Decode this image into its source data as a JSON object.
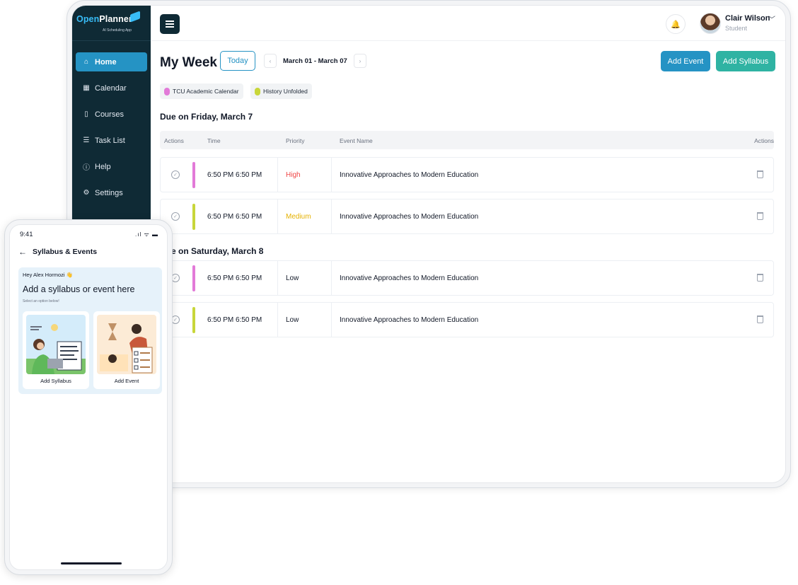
{
  "app": {
    "logo_open": "Open",
    "logo_planner": "Planner",
    "logo_sub": "AI Scheduling App"
  },
  "sidebar": {
    "items": [
      {
        "label": "Home",
        "icon": "home-icon",
        "glyph": "⌂",
        "active": true
      },
      {
        "label": "Calendar",
        "icon": "calendar-icon",
        "glyph": "▦",
        "active": false
      },
      {
        "label": "Courses",
        "icon": "book-icon",
        "glyph": "▯",
        "active": false
      },
      {
        "label": "Task List",
        "icon": "task-list-icon",
        "glyph": "☰",
        "active": false
      },
      {
        "label": "Help",
        "icon": "help-icon",
        "glyph": "ⓘ",
        "active": false
      },
      {
        "label": "Settings",
        "icon": "settings-icon",
        "glyph": "⚙",
        "active": false
      }
    ]
  },
  "header": {
    "user_name": "Clair Wilson",
    "user_role": "Student"
  },
  "main": {
    "title": "My Week",
    "today_label": "Today",
    "prev_label": "‹",
    "next_label": "›",
    "date_range": "March 01 - March 07",
    "add_event_label": "Add Event",
    "add_syllabus_label": "Add Syllabus",
    "tags": [
      {
        "label": "TCU Academic Calendar",
        "color": "#e27ad8"
      },
      {
        "label": "History Unfolded",
        "color": "#c8d63a"
      }
    ],
    "table_headers": {
      "actions": "Actions",
      "time": "Time",
      "priority": "Priority",
      "event_name": "Event Name",
      "actions_right": "Actions"
    },
    "sections": [
      {
        "heading": "Due on Friday, March 7",
        "rows": [
          {
            "time": "6:50 PM 6:50 PM",
            "priority": "High",
            "priority_color": "#ef4444",
            "bar_color": "#e27ad8",
            "event": "Innovative Approaches to Modern Education"
          },
          {
            "time": "6:50 PM 6:50 PM",
            "priority": "Medium",
            "priority_color": "#e5b100",
            "bar_color": "#c8d63a",
            "event": "Innovative Approaches to Modern Education"
          }
        ]
      },
      {
        "heading": "Due on Saturday, March 8",
        "rows": [
          {
            "time": "6:50 PM 6:50 PM",
            "priority": "Low",
            "priority_color": "#111827",
            "bar_color": "#e27ad8",
            "event": "Innovative Approaches to Modern Education"
          },
          {
            "time": "6:50 PM 6:50 PM",
            "priority": "Low",
            "priority_color": "#111827",
            "bar_color": "#c8d63a",
            "event": "Innovative Approaches to Modern Education"
          }
        ]
      }
    ]
  },
  "phone": {
    "time": "9:41",
    "status": ".ıl ᯤ ▬",
    "title": "Syllabus & Events",
    "greeting": "Hey Alex Hormozi 👋",
    "heading": "Add a syllabus or event here",
    "subtext": "Select an option below!",
    "option_syllabus": "Add Syllabus",
    "option_event": "Add Event"
  },
  "colors": {
    "sidebar_bg": "#0f2a35",
    "accent_blue": "#2593c4",
    "accent_teal": "#2fb3a3"
  }
}
